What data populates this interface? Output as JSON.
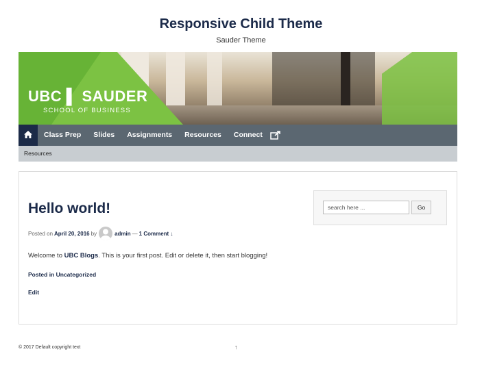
{
  "site": {
    "title": "Responsive Child Theme",
    "description": "Sauder Theme"
  },
  "banner": {
    "logo_main": "UBC ▌ SAUDER",
    "logo_sub": "SCHOOL OF BUSINESS"
  },
  "nav": {
    "items": [
      "Class Prep",
      "Slides",
      "Assignments",
      "Resources",
      "Connect"
    ],
    "home_icon": "home-icon",
    "external_icon": "external-link-icon"
  },
  "subnav": {
    "item": "Resources"
  },
  "post": {
    "title": "Hello world!",
    "posted_on_label": "Posted on",
    "date": "April 20, 2016",
    "by_label": "by",
    "author": "admin",
    "separator": "—",
    "comments": "1 Comment ↓",
    "excerpt_before": "Welcome to ",
    "excerpt_link": "UBC Blogs",
    "excerpt_after": ". This is your first post. Edit or delete it, then start blogging!",
    "posted_in": "Posted in Uncategorized",
    "edit": "Edit"
  },
  "search": {
    "placeholder": "search here ...",
    "button": "Go"
  },
  "footer": {
    "copyright": "© 2017 Default copyright text",
    "top_link": "↑"
  },
  "colors": {
    "navy": "#1b2a49",
    "nav_bg": "#5b6771",
    "subnav_bg": "#c8cdd1",
    "ubc_green": "#7cc243"
  }
}
